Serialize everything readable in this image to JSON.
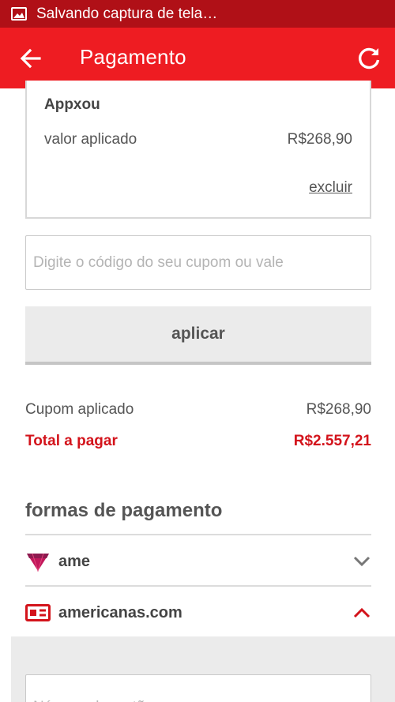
{
  "status_bar": {
    "notification_text": "Salvando captura de tela…"
  },
  "header": {
    "title": "Pagamento",
    "back_icon": "arrow-left-icon",
    "refresh_icon": "refresh-icon"
  },
  "voucher": {
    "name": "Appxou",
    "label": "valor aplicado",
    "value": "R$268,90",
    "remove_label": "excluir"
  },
  "coupon": {
    "placeholder": "Digite o código do seu cupom ou vale",
    "value": "",
    "apply_label": "aplicar"
  },
  "summary": {
    "coupon_label": "Cupom aplicado",
    "coupon_value": "R$268,90",
    "total_label": "Total a pagar",
    "total_value": "R$2.557,21"
  },
  "payment_methods": {
    "title": "formas de pagamento",
    "items": [
      {
        "label": "ame",
        "icon": "ame-heart-icon",
        "expanded": false
      },
      {
        "label": "americanas.com",
        "icon": "americanas-card-icon",
        "expanded": true
      }
    ],
    "card_number_placeholder": "Número do cartão"
  },
  "colors": {
    "brand_red": "#ee1c22",
    "status_bar": "#b01017",
    "total_red": "#d3131b",
    "chevron_active": "#d3131b"
  }
}
